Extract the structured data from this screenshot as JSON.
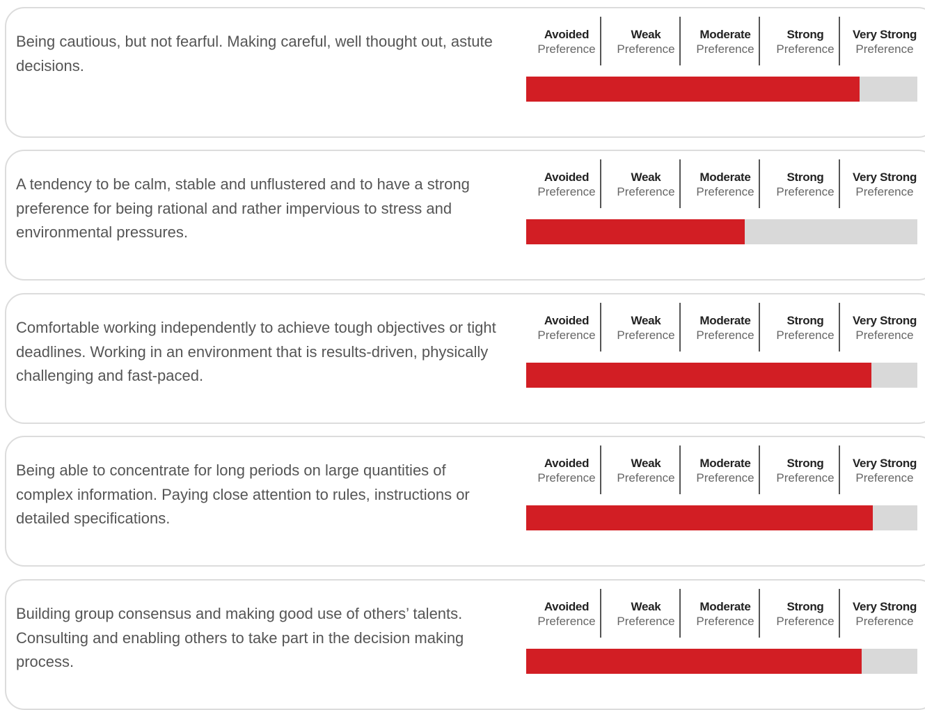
{
  "scale_labels": [
    {
      "title": "Avoided",
      "sub": "Preference"
    },
    {
      "title": "Weak",
      "sub": "Preference"
    },
    {
      "title": "Moderate",
      "sub": "Preference"
    },
    {
      "title": "Strong",
      "sub": "Preference"
    },
    {
      "title": "Very Strong",
      "sub": "Preference"
    }
  ],
  "colors": {
    "bar_fill": "#d21e24",
    "bar_track": "#d9d9d9",
    "card_border": "#dcdcdc"
  },
  "items": [
    {
      "description": "Being cautious, but not fearful. Making careful, well thought out, astute decisions.",
      "score_fraction": 0.853
    },
    {
      "description": "A tendency to be calm, stable and unflustered and to have a strong preference for being rational and rather impervious to stress and environmental pressures.",
      "score_fraction": 0.558
    },
    {
      "description": "Comfortable working independently to achieve tough objectives or tight deadlines. Working in an environment that is results-driven, physically challenging and fast-paced.",
      "score_fraction": 0.882
    },
    {
      "description": "Being able to concentrate for long periods on large quantities of complex information. Paying close attention to rules, instructions or detailed specifications.",
      "score_fraction": 0.887
    },
    {
      "description": "Building group consensus and making good use of others’ talents. Consulting and enabling others to take part in the decision making process.",
      "score_fraction": 0.858
    }
  ]
}
